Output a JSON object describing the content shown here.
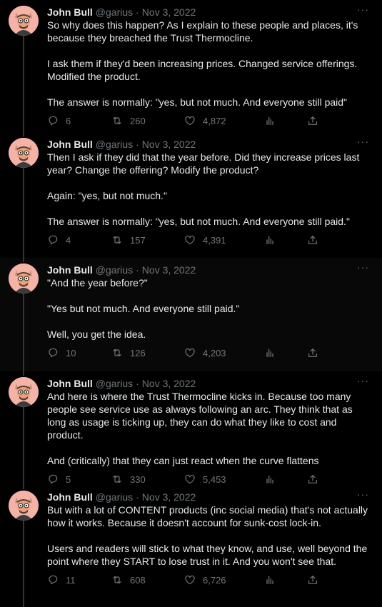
{
  "tweets": [
    {
      "author": "John Bull",
      "handle": "@garius",
      "date": "Nov 3, 2022",
      "paragraphs": [
        "So why does this happen? As I explain to these people and places, it's because they breached the Trust Thermocline.",
        "I ask them if they'd been increasing prices. Changed service offerings. Modified the product.",
        "The answer is normally: \"yes, but not much. And everyone still paid\""
      ],
      "replies": "6",
      "retweets": "260",
      "likes": "4,872"
    },
    {
      "author": "John Bull",
      "handle": "@garius",
      "date": "Nov 3, 2022",
      "paragraphs": [
        "Then I ask if they did that the year before. Did they increase prices last year? Change the offering? Modify the product?",
        "Again: \"yes, but not much.\"",
        "The answer is normally: \"yes, but not much. And everyone still paid.\""
      ],
      "replies": "4",
      "retweets": "157",
      "likes": "4,391"
    },
    {
      "author": "John Bull",
      "handle": "@garius",
      "date": "Nov 3, 2022",
      "paragraphs": [
        "\"And the year before?\"",
        "\"Yes but not much. And everyone still paid.\"",
        "Well, you get the idea."
      ],
      "replies": "10",
      "retweets": "126",
      "likes": "4,203"
    },
    {
      "author": "John Bull",
      "handle": "@garius",
      "date": "Nov 3, 2022",
      "paragraphs": [
        "And here is where the Trust Thermocline kicks in. Because too many people see service use as always following an arc. They think that as long as usage is ticking up, they can do what they like to cost and product.",
        "And (critically) that they can just react when the curve flattens"
      ],
      "replies": "5",
      "retweets": "330",
      "likes": "5,453"
    },
    {
      "author": "John Bull",
      "handle": "@garius",
      "date": "Nov 3, 2022",
      "paragraphs": [
        "But with a lot of CONTENT products (inc social media) that's not actually how it works. Because it doesn't account for sunk-cost lock-in.",
        "Users and readers will stick to what they know, and use, well beyond the point where they START to lose trust in it. And you won't see that."
      ],
      "replies": "11",
      "retweets": "608",
      "likes": "6,726"
    }
  ],
  "separator": "·",
  "more_icon": "···",
  "colors": {
    "background": "#000000",
    "text": "#e7e9ea",
    "muted": "#71767b",
    "thread_line": "#333639",
    "highlight": "#080808"
  },
  "icons": [
    "avatar",
    "more-icon",
    "reply-icon",
    "retweet-icon",
    "like-icon",
    "views-icon",
    "share-icon"
  ]
}
